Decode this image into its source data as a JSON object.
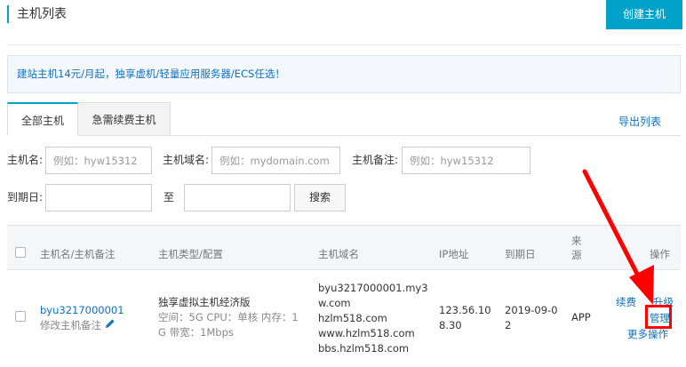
{
  "header": {
    "title": "主机列表",
    "create_button": "创建主机"
  },
  "notice": "建站主机14元/月起，独享虚机/轻量应用服务器/ECS任选！",
  "tabs": [
    {
      "label": "全部主机",
      "active": true
    },
    {
      "label": "急需续费主机",
      "active": false
    }
  ],
  "export_link": "导出列表",
  "filters": {
    "hostname_label": "主机名:",
    "hostname_placeholder": "例如：hyw15312",
    "domain_label": "主机域名:",
    "domain_placeholder": "例如：mydomain.com",
    "remark_label": "主机备注:",
    "remark_placeholder": "例如：hyw15312",
    "expiry_label": "到期日:",
    "to_label": "至",
    "search_button": "搜索"
  },
  "table": {
    "columns": {
      "name": "主机名/主机备注",
      "type": "主机类型/配置",
      "domain": "主机域名",
      "ip": "IP地址",
      "expiry": "到期日",
      "source_1": "来",
      "source_2": "源",
      "actions": "操作"
    },
    "rows": [
      {
        "hostname": "byu3217000001",
        "edit_remark": "修改主机备注",
        "type_title": "独享虚拟主机经济版",
        "type_spec_1": "空间：5G CPU：单核 内存：1",
        "type_spec_2": "G 带宽：1Mbps",
        "domains": [
          "byu3217000001.my3",
          "w.com",
          "hzlm518.com",
          "www.hzlm518.com",
          "bbs.hzlm518.com"
        ],
        "ip_1": "123.56.10",
        "ip_2": "8.30",
        "expiry_1": "2019-09-0",
        "expiry_2": "2",
        "source": "APP",
        "action_renew": "续费",
        "action_upgrade": "升级",
        "action_manage": "管理",
        "action_more": "更多操作"
      }
    ]
  },
  "colors": {
    "accent": "#00a2ca",
    "link": "#0b72c4",
    "annotation": "#ff0000"
  }
}
